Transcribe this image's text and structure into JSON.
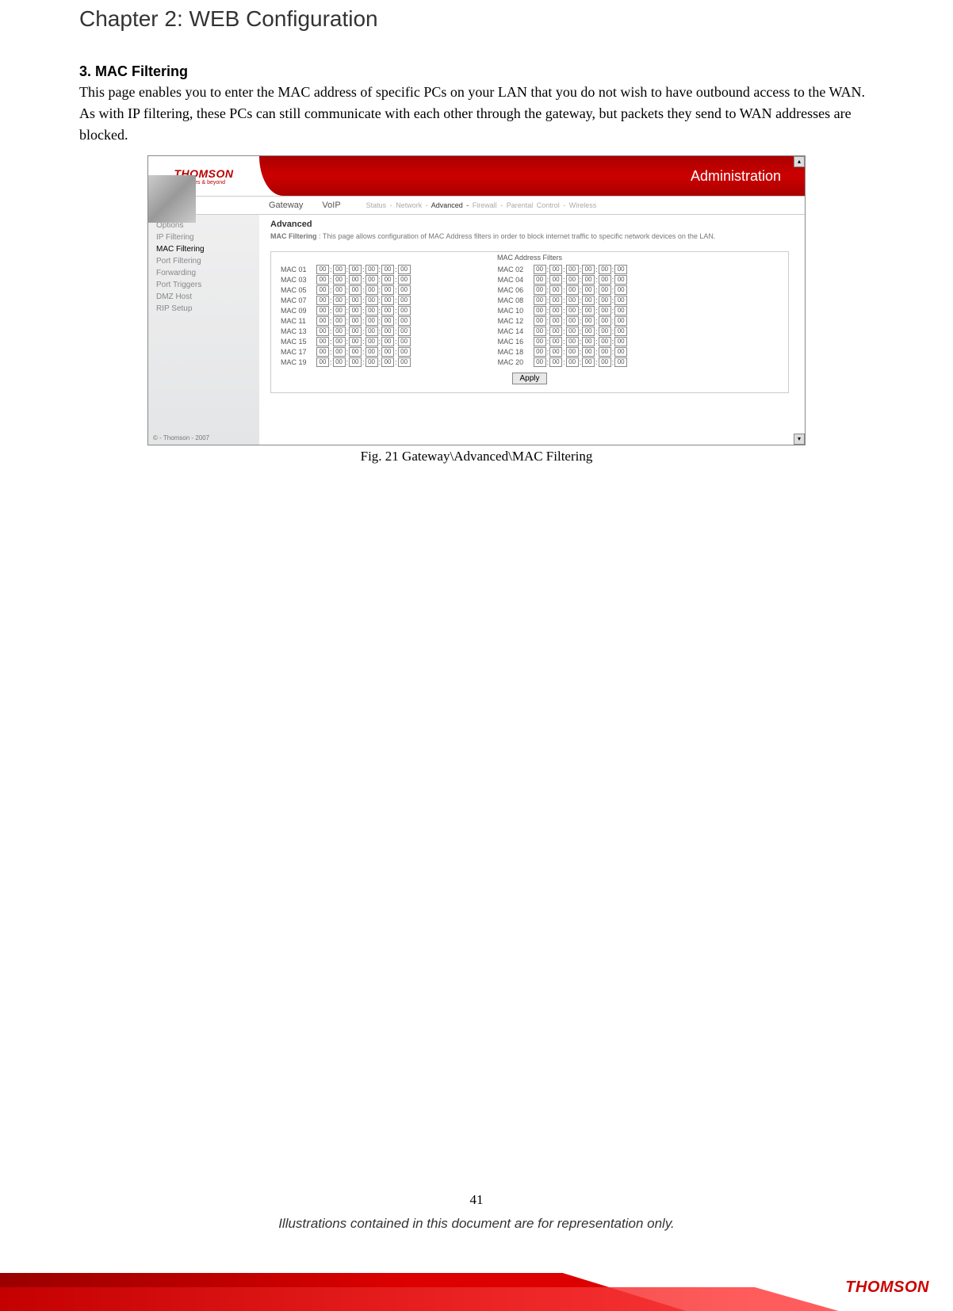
{
  "chapterTitle": "Chapter 2: WEB Configuration",
  "section": {
    "heading": "3. MAC Filtering",
    "body": "This page enables you to enter the MAC address of specific PCs on your LAN that you do not wish to have outbound access to the WAN. As with IP filtering, these PCs can still communicate with each other through the gateway, but packets they send to WAN addresses are blocked."
  },
  "screenshot": {
    "brand": "THOMSON",
    "brandSub": "images & beyond",
    "bannerTitle": "Administration",
    "tabs": {
      "primary": "Gateway",
      "secondary": "VoIP"
    },
    "subnav": {
      "items": [
        {
          "label": "Status -",
          "active": false
        },
        {
          "label": "Network -",
          "active": false
        },
        {
          "label": "Advanced -",
          "active": true
        },
        {
          "label": "Firewall -",
          "active": false
        },
        {
          "label": "Parental Control -",
          "active": false
        },
        {
          "label": "Wireless",
          "active": false
        }
      ]
    },
    "sidebar": {
      "items": [
        "Options",
        "IP Filtering",
        "MAC Filtering",
        "Port Filtering",
        "Forwarding",
        "Port Triggers",
        "DMZ Host",
        "RIP Setup"
      ],
      "activeIndex": 2,
      "footer": "© - Thomson - 2007"
    },
    "main": {
      "heading": "Advanced",
      "descLabel": "MAC Filtering",
      "desc": ": This page allows configuration of MAC Address filters in order to block internet traffic to specific network devices on the LAN.",
      "tableTitle": "MAC Address Filters",
      "entries": [
        {
          "label": "MAC 01",
          "octets": [
            "00",
            "00",
            "00",
            "00",
            "00",
            "00"
          ]
        },
        {
          "label": "MAC 02",
          "octets": [
            "00",
            "00",
            "00",
            "00",
            "00",
            "00"
          ]
        },
        {
          "label": "MAC 03",
          "octets": [
            "00",
            "00",
            "00",
            "00",
            "00",
            "00"
          ]
        },
        {
          "label": "MAC 04",
          "octets": [
            "00",
            "00",
            "00",
            "00",
            "00",
            "00"
          ]
        },
        {
          "label": "MAC 05",
          "octets": [
            "00",
            "00",
            "00",
            "00",
            "00",
            "00"
          ]
        },
        {
          "label": "MAC 06",
          "octets": [
            "00",
            "00",
            "00",
            "00",
            "00",
            "00"
          ]
        },
        {
          "label": "MAC 07",
          "octets": [
            "00",
            "00",
            "00",
            "00",
            "00",
            "00"
          ]
        },
        {
          "label": "MAC 08",
          "octets": [
            "00",
            "00",
            "00",
            "00",
            "00",
            "00"
          ]
        },
        {
          "label": "MAC 09",
          "octets": [
            "00",
            "00",
            "00",
            "00",
            "00",
            "00"
          ]
        },
        {
          "label": "MAC 10",
          "octets": [
            "00",
            "00",
            "00",
            "00",
            "00",
            "00"
          ]
        },
        {
          "label": "MAC 11",
          "octets": [
            "00",
            "00",
            "00",
            "00",
            "00",
            "00"
          ]
        },
        {
          "label": "MAC 12",
          "octets": [
            "00",
            "00",
            "00",
            "00",
            "00",
            "00"
          ]
        },
        {
          "label": "MAC 13",
          "octets": [
            "00",
            "00",
            "00",
            "00",
            "00",
            "00"
          ]
        },
        {
          "label": "MAC 14",
          "octets": [
            "00",
            "00",
            "00",
            "00",
            "00",
            "00"
          ]
        },
        {
          "label": "MAC 15",
          "octets": [
            "00",
            "00",
            "00",
            "00",
            "00",
            "00"
          ]
        },
        {
          "label": "MAC 16",
          "octets": [
            "00",
            "00",
            "00",
            "00",
            "00",
            "00"
          ]
        },
        {
          "label": "MAC 17",
          "octets": [
            "00",
            "00",
            "00",
            "00",
            "00",
            "00"
          ]
        },
        {
          "label": "MAC 18",
          "octets": [
            "00",
            "00",
            "00",
            "00",
            "00",
            "00"
          ]
        },
        {
          "label": "MAC 19",
          "octets": [
            "00",
            "00",
            "00",
            "00",
            "00",
            "00"
          ]
        },
        {
          "label": "MAC 20",
          "octets": [
            "00",
            "00",
            "00",
            "00",
            "00",
            "00"
          ]
        }
      ],
      "applyLabel": "Apply"
    }
  },
  "figureCaption": "Fig. 21 Gateway\\Advanced\\MAC Filtering",
  "pageNumber": "41",
  "disclaimer": "Illustrations contained in this document are for representation only.",
  "footerBrand": "THOMSON"
}
